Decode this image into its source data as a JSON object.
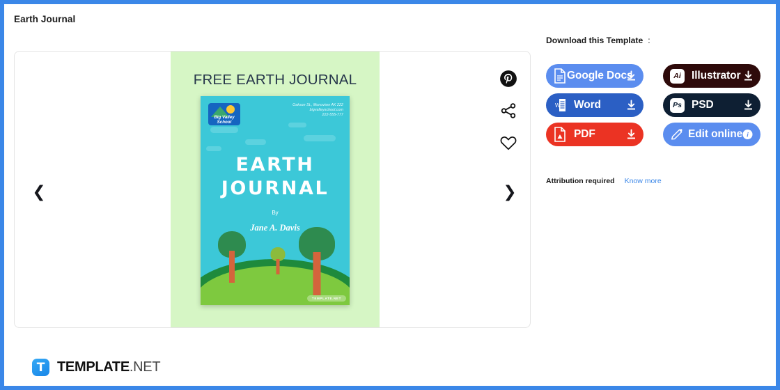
{
  "page": {
    "title": "Earth Journal"
  },
  "preview": {
    "heading": "FREE EARTH JOURNAL",
    "prev_icon": "chevron-left-icon",
    "next_icon": "chevron-right-icon",
    "watermark": "TEMPLATE.NET",
    "cover": {
      "logo_line1": "Big Valley",
      "logo_line2": "School",
      "address_line1": "Oakson St., Monoview AK 222",
      "address_line2": "bigvalleyschool.com",
      "address_line3": "222-555-777",
      "title_line1": "EARTH",
      "title_line2": "JOURNAL",
      "by_label": "By",
      "author": "Jane A. Davis"
    }
  },
  "side_actions": [
    {
      "name": "pinterest-icon",
      "label": "Pin this template"
    },
    {
      "name": "share-icon",
      "label": "Share"
    },
    {
      "name": "favorite-heart-icon",
      "label": "Save to favorites"
    }
  ],
  "download": {
    "heading": "Download this Template",
    "colon": ":",
    "buttons": [
      {
        "label": "Google Docs",
        "icon": "google-docs-file-icon",
        "trail": "download-icon",
        "color": "#5b8def"
      },
      {
        "label": "Illustrator",
        "icon": "illustrator-ai-icon",
        "badge": "Ai",
        "trail": "download-icon",
        "color": "#2e0a0a"
      },
      {
        "label": "Word",
        "icon": "word-file-icon",
        "badge": "W",
        "trail": "download-icon",
        "color": "#2b5fc4"
      },
      {
        "label": "PSD",
        "icon": "photoshop-ps-icon",
        "badge": "Ps",
        "trail": "download-icon",
        "color": "#0e1f33"
      },
      {
        "label": "PDF",
        "icon": "pdf-file-icon",
        "trail": "download-icon",
        "color": "#eb3323"
      },
      {
        "label": "Edit online",
        "icon": "pencil-edit-icon",
        "trail": "info-icon",
        "color": "#5b8def"
      }
    ]
  },
  "attribution": {
    "text": "Attribution required",
    "link": "Know more"
  },
  "footer": {
    "logo_mark": "T",
    "brand_bold": "TEMPLATE",
    "brand_light": ".NET"
  }
}
